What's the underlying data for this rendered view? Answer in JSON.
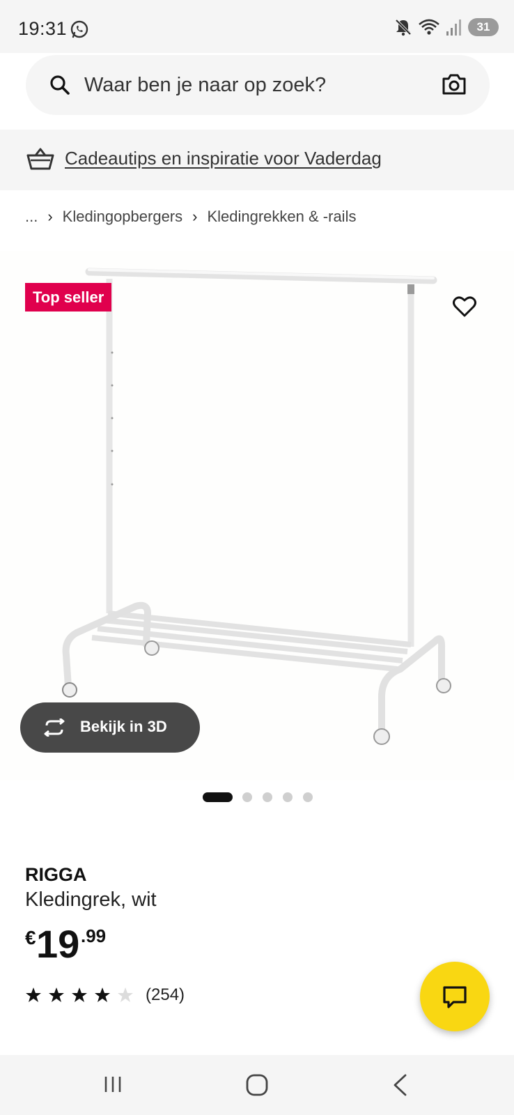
{
  "status_bar": {
    "time": "19:31",
    "battery": "31",
    "icons": [
      "whatsapp-icon",
      "mute-icon",
      "wifi-icon",
      "signal-icon",
      "battery-icon"
    ]
  },
  "search": {
    "placeholder": "Waar ben je naar op zoek?"
  },
  "promo": {
    "link_text": "Cadeautips en inspiratie voor Vaderdag"
  },
  "breadcrumb": {
    "items": [
      "...",
      "Kledingopbergers",
      "Kledingrekken & -rails"
    ]
  },
  "gallery": {
    "badge": "Top seller",
    "view3d_label": "Bekijk in 3D",
    "slide_count": 5,
    "active_slide": 1
  },
  "product": {
    "name": "RIGGA",
    "description": "Kledingrek, wit",
    "price_currency": "€",
    "price_int": "19",
    "price_dec": ".99",
    "rating": 4,
    "rating_max": 5,
    "review_count": "(254)"
  },
  "colors": {
    "badge": "#e0004d",
    "chat_button": "#f9d712",
    "view3d_button": "#484848"
  }
}
